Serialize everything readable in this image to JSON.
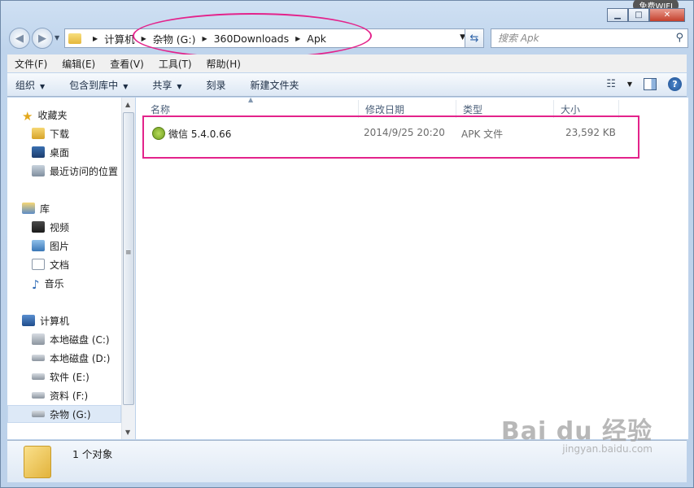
{
  "window": {
    "wifi_badge": "免费WIFI",
    "minimize_icon": "minimize-icon",
    "maximize_icon": "maximize-icon",
    "close_icon": "close-icon"
  },
  "address_bar": {
    "crumbs": [
      "计算机",
      "杂物 (G:)",
      "360Downloads",
      "Apk"
    ]
  },
  "search": {
    "placeholder": "搜索 Apk"
  },
  "menu": [
    "文件(F)",
    "编辑(E)",
    "查看(V)",
    "工具(T)",
    "帮助(H)"
  ],
  "toolbar": {
    "organize": "组织",
    "include_in_library": "包含到库中",
    "share": "共享",
    "burn": "刻录",
    "new_folder": "新建文件夹"
  },
  "nav_pane": {
    "favorites": {
      "label": "收藏夹",
      "items": [
        "下载",
        "桌面",
        "最近访问的位置"
      ]
    },
    "libraries": {
      "label": "库",
      "items": [
        "视频",
        "图片",
        "文档",
        "音乐"
      ]
    },
    "computer": {
      "label": "计算机",
      "items": [
        "本地磁盘 (C:)",
        "本地磁盘 (D:)",
        "软件 (E:)",
        "资料 (F:)",
        "杂物 (G:)"
      ]
    },
    "selected": "杂物 (G:)"
  },
  "columns": [
    "名称",
    "修改日期",
    "类型",
    "大小"
  ],
  "files": [
    {
      "name": "微信 5.4.0.66",
      "modified": "2014/9/25 20:20",
      "type": "APK 文件",
      "size": "23,592 KB",
      "icon": "apk-android-icon"
    }
  ],
  "status": {
    "count": "1 个对象"
  },
  "watermark": {
    "line1": "Bai du 经验",
    "line2": "jingyan.baidu.com"
  },
  "colors": {
    "highlight": "#e3238b",
    "selection": "#dde9f7"
  }
}
